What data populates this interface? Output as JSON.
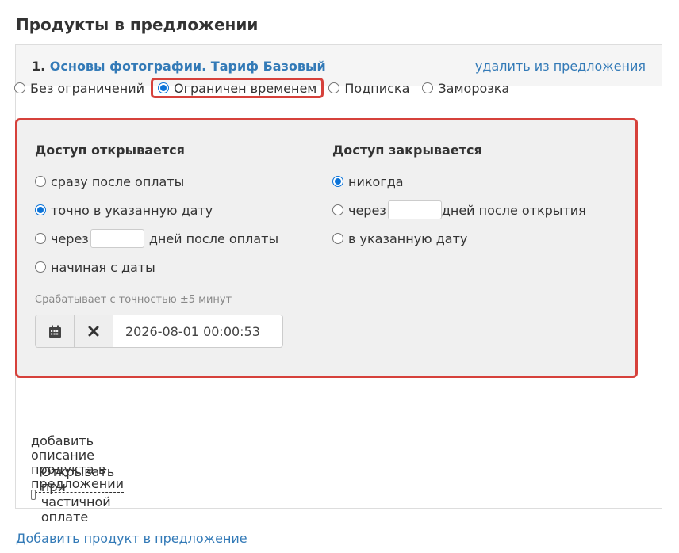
{
  "section": {
    "title": "Продукты в предложении"
  },
  "product": {
    "number": "1.",
    "name": "Основы фотографии. Тариф Базовый",
    "remove_label": "удалить из предложения"
  },
  "access_types": [
    {
      "label": "Без ограничений",
      "checked": false
    },
    {
      "label": "Ограничен временем",
      "checked": true
    },
    {
      "label": "Подписка",
      "checked": false
    },
    {
      "label": "Заморозка",
      "checked": false
    }
  ],
  "open_access": {
    "title": "Доступ открывается",
    "options": {
      "immediately": "сразу после оплаты",
      "exact_date": "точно в указанную дату",
      "after_prefix": "через",
      "after_suffix": "дней после оплаты",
      "starting_from": "начиная с даты"
    },
    "selected": "exact_date",
    "hint": "Срабатывает с точностью ±5 минут",
    "date_value": "2026-08-01 00:00:53"
  },
  "close_access": {
    "title": "Доступ закрывается",
    "options": {
      "never": "никогда",
      "after_prefix": "через",
      "after_suffix": "дней после открытия",
      "at_date": "в указанную дату"
    },
    "selected": "never"
  },
  "description_link": "добавить описание продукта в предложении",
  "partial_payment": {
    "label": "Открывать при частичной оплате",
    "checked": false
  },
  "add_product_link": "Добавить продукт в предложение",
  "colors": {
    "link": "#337ab7",
    "highlight": "#d6413b",
    "radio_checked": "#0b73d8",
    "box_bg": "#f0f0f0"
  },
  "icons": {
    "calendar": "calendar-icon",
    "clear": "close-icon"
  }
}
